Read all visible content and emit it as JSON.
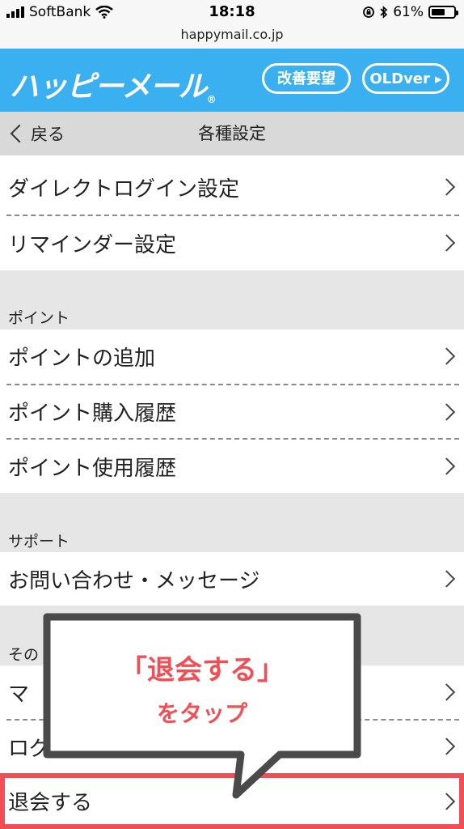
{
  "status_bar": {
    "carrier": "SoftBank",
    "time": "18:18",
    "battery_percent": "61%",
    "battery_level": 0.61
  },
  "browser": {
    "url": "happymail.co.jp"
  },
  "header": {
    "logo_text": "ハッピーメール",
    "logo_mark": "®",
    "improve_button": "改善要望",
    "old_version_button": "OLDver",
    "brand_color": "#3ab0f0"
  },
  "nav": {
    "back_label": "戻る",
    "title": "各種設定"
  },
  "settings": {
    "login_items": [
      {
        "label": "ダイレクトログイン設定"
      },
      {
        "label": "リマインダー設定"
      }
    ],
    "point_section": {
      "header": "ポイント",
      "items": [
        {
          "label": "ポイントの追加"
        },
        {
          "label": "ポイント購入履歴"
        },
        {
          "label": "ポイント使用履歴"
        }
      ]
    },
    "support_section": {
      "header": "サポート",
      "items": [
        {
          "label": "お問い合わせ・メッセージ"
        }
      ]
    },
    "other_section": {
      "header": "その",
      "items": [
        {
          "label": "マ"
        },
        {
          "label": "ログ"
        },
        {
          "label": "退会する"
        }
      ]
    }
  },
  "annotation": {
    "line1": "「退会する」",
    "line2": "をタップ",
    "accent_color": "#f04f55"
  }
}
